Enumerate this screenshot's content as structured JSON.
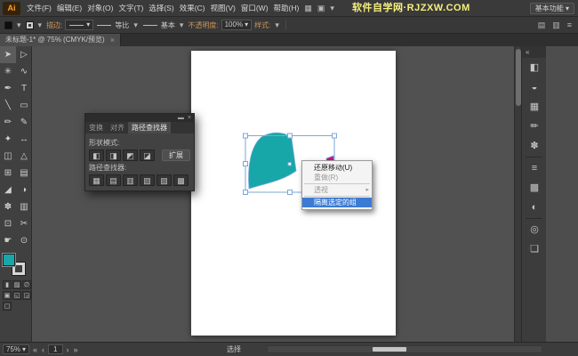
{
  "app": {
    "logo": "Ai",
    "watermark": "软件自学网·RJZXW.COM",
    "workspace": "基本功能"
  },
  "ui": {
    "dropdown_arrow": "▾",
    "submenu_arrow": "▸",
    "close": "×",
    "collapse_left": "«",
    "panel_menu": "≡",
    "minimize": "▬"
  },
  "menu": {
    "items": [
      "文件(F)",
      "编辑(E)",
      "对象(O)",
      "文字(T)",
      "选择(S)",
      "效果(C)",
      "视图(V)",
      "窗口(W)",
      "帮助(H)"
    ],
    "bar_icons": [
      {
        "name": "bridge-icon",
        "glyph": "▦"
      },
      {
        "name": "arrange-documents-icon",
        "glyph": "▣"
      }
    ]
  },
  "control_bar": {
    "stroke_label": "描边:",
    "uniform_label": "等比",
    "brush_label": "基本",
    "opacity_label": "不透明度:",
    "opacity_value": "100%",
    "style_label": "样式:",
    "right_icons": [
      {
        "name": "align-panel-icon",
        "glyph": "▤"
      },
      {
        "name": "transform-panel-icon",
        "glyph": "▥"
      },
      {
        "name": "control-menu-icon",
        "glyph": "≡"
      }
    ]
  },
  "document_tab": {
    "title": "未标题-1* @ 75% (CMYK/预览)"
  },
  "toolbar": {
    "tools": [
      {
        "name": "selection-tool",
        "glyph": "➤"
      },
      {
        "name": "direct-selection-tool",
        "glyph": "▷"
      },
      {
        "name": "magic-wand-tool",
        "glyph": "✳"
      },
      {
        "name": "lasso-tool",
        "glyph": "∿"
      },
      {
        "name": "pen-tool",
        "glyph": "✒"
      },
      {
        "name": "type-tool",
        "glyph": "T"
      },
      {
        "name": "line-segment-tool",
        "glyph": "╲"
      },
      {
        "name": "rectangle-tool",
        "glyph": "▭"
      },
      {
        "name": "paintbrush-tool",
        "glyph": "✏"
      },
      {
        "name": "pencil-tool",
        "glyph": "✎"
      },
      {
        "name": "width-tool",
        "glyph": "✦"
      },
      {
        "name": "free-transform-tool",
        "glyph": "↔"
      },
      {
        "name": "shape-builder-tool",
        "glyph": "◫"
      },
      {
        "name": "perspective-grid-tool",
        "glyph": "△"
      },
      {
        "name": "mesh-tool",
        "glyph": "⊞"
      },
      {
        "name": "gradient-tool",
        "glyph": "▤"
      },
      {
        "name": "eyedropper-tool",
        "glyph": "◢"
      },
      {
        "name": "blend-tool",
        "glyph": "◑"
      },
      {
        "name": "symbol-sprayer-tool",
        "glyph": "✽"
      },
      {
        "name": "column-graph-tool",
        "glyph": "▥"
      },
      {
        "name": "artboard-tool",
        "glyph": "⊡"
      },
      {
        "name": "slice-tool",
        "glyph": "✂"
      },
      {
        "name": "hand-tool",
        "glyph": "☛"
      },
      {
        "name": "zoom-tool",
        "glyph": "⊙"
      }
    ],
    "extras": [
      {
        "name": "color-mode-icon",
        "glyph": "▮"
      },
      {
        "name": "gradient-mode-icon",
        "glyph": "▨"
      },
      {
        "name": "none-mode-icon",
        "glyph": "∅"
      },
      {
        "name": "draw-normal-icon",
        "glyph": "▣"
      },
      {
        "name": "draw-behind-icon",
        "glyph": "◱"
      },
      {
        "name": "draw-inside-icon",
        "glyph": "◲"
      },
      {
        "name": "screen-mode-icon",
        "glyph": "▢"
      }
    ]
  },
  "panel": {
    "tabs": [
      "变换",
      "对齐",
      "路径查找器"
    ],
    "shape_modes_label": "形状模式:",
    "expand_button": "扩展",
    "pathfinder_label": "路径查找器:",
    "shape_mode_buttons": [
      {
        "name": "unite-button",
        "glyph": "◧"
      },
      {
        "name": "minus-front-button",
        "glyph": "◨"
      },
      {
        "name": "intersect-button",
        "glyph": "◩"
      },
      {
        "name": "exclude-button",
        "glyph": "◪"
      }
    ],
    "pathfinder_buttons": [
      {
        "name": "divide-button",
        "glyph": "▦"
      },
      {
        "name": "trim-button",
        "glyph": "▤"
      },
      {
        "name": "merge-button",
        "glyph": "▥"
      },
      {
        "name": "crop-button",
        "glyph": "▧"
      },
      {
        "name": "outline-button",
        "glyph": "▨"
      },
      {
        "name": "minus-back-button",
        "glyph": "▩"
      }
    ]
  },
  "context_menu": {
    "items": [
      {
        "label": "还原移动(U)"
      },
      {
        "label": "重做(R)"
      },
      {
        "label": "透视"
      },
      {
        "label": "隔离选定的组"
      }
    ]
  },
  "dock": {
    "icons": [
      {
        "name": "color-panel-icon",
        "glyph": "◧"
      },
      {
        "name": "color-guide-panel-icon",
        "glyph": "◒"
      },
      {
        "name": "swatches-panel-icon",
        "glyph": "▦"
      },
      {
        "name": "brushes-panel-icon",
        "glyph": "✏"
      },
      {
        "name": "symbols-panel-icon",
        "glyph": "✽"
      },
      {
        "name": "stroke-panel-icon",
        "glyph": "≡"
      },
      {
        "name": "gradient-panel-icon",
        "glyph": "▩"
      },
      {
        "name": "transparency-panel-icon",
        "glyph": "◐"
      },
      {
        "name": "appearance-panel-icon",
        "glyph": "◎"
      },
      {
        "name": "layers-panel-icon",
        "glyph": "❏"
      }
    ]
  },
  "status_bar": {
    "zoom": "75%",
    "artboard_number": "1",
    "nav_first": "«",
    "nav_prev": "‹",
    "nav_next": "›",
    "nav_last": "»",
    "tool_status": "选择"
  },
  "colors": {
    "teal_shape": "#17A7A9",
    "magenta_shape": "#C2188C",
    "selection_blue": "#7DA7D9",
    "watermark_yellow": "#F5EF7D",
    "highlight_blue": "#3B7BD4"
  }
}
